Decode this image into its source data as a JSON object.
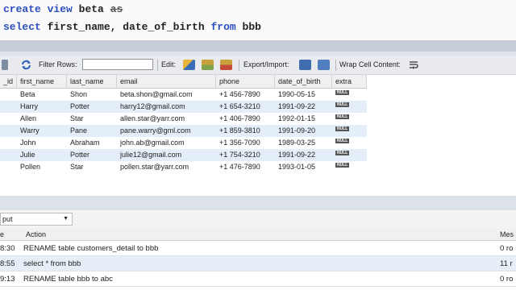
{
  "editor": {
    "line1": {
      "kw1": "create",
      "kw2": "view",
      "ident": "beta",
      "struck": "as"
    },
    "line2": {
      "kw1": "select",
      "cols": "first_name, date_of_birth",
      "kw2": "from",
      "table": "bbb"
    }
  },
  "toolbar": {
    "filter_label": "Filter Rows:",
    "filter_value": "",
    "edit_label": "Edit:",
    "export_label": "Export/Import:",
    "wrap_label": "Wrap Cell Content:"
  },
  "grid": {
    "columns": [
      "_id",
      "first_name",
      "last_name",
      "email",
      "phone",
      "date_of_birth",
      "extra"
    ],
    "null_label": "NULL",
    "rows": [
      [
        "Beta",
        "Shon",
        "beta.shon@gmail.com",
        "+1 456-7890",
        "1990-05-15"
      ],
      [
        "Harry",
        "Potter",
        "harry12@gmail.com",
        "+1 654-3210",
        "1991-09-22"
      ],
      [
        "Allen",
        "Star",
        "allen.star@yarr.com",
        "+1 406-7890",
        "1992-01-15"
      ],
      [
        "Warry",
        "Pane",
        "pane.warry@gml.com",
        "+1 859-3810",
        "1991-09-20"
      ],
      [
        "John",
        "Abraham",
        "john.ab@gmail.com",
        "+1 356-7090",
        "1989-03-25"
      ],
      [
        "Julie",
        "Potter",
        "julie12@gmail.com",
        "+1 754-3210",
        "1991-09-22"
      ],
      [
        "Pollen",
        "Star",
        "pollen.star@yarr.com",
        "+1 476-7890",
        "1993-01-05"
      ]
    ]
  },
  "output": {
    "selector": "put",
    "col_time": "e",
    "col_action": "Action",
    "col_message": "Mes",
    "rows": [
      {
        "time": "8:30",
        "action": "RENAME table customers_detail  to  bbb",
        "message": "0 ro"
      },
      {
        "time": "8:55",
        "action": "select * from bbb",
        "message": "11 r"
      },
      {
        "time": "9:13",
        "action": "RENAME table bbb to abc",
        "message": "0 ro"
      }
    ]
  }
}
